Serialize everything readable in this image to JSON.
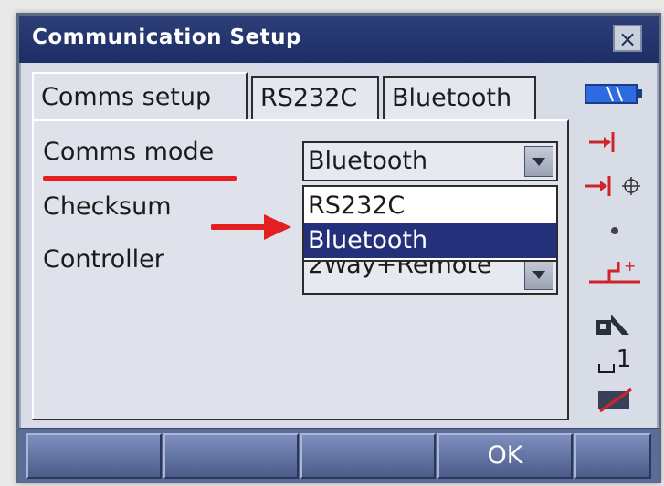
{
  "window": {
    "title": "Communication Setup",
    "close_label": "×"
  },
  "tabs": [
    {
      "label": "Comms setup",
      "active": true
    },
    {
      "label": "RS232C",
      "active": false
    },
    {
      "label": "Bluetooth",
      "active": false
    }
  ],
  "fields": {
    "comms_mode": {
      "label": "Comms mode",
      "value": "Bluetooth"
    },
    "checksum": {
      "label": "Checksum"
    },
    "controller": {
      "label": "Controller",
      "value": "2Way+Remote"
    }
  },
  "dropdown": {
    "options": [
      {
        "label": "RS232C",
        "selected": false
      },
      {
        "label": "Bluetooth",
        "selected": true
      }
    ]
  },
  "side_panel": {
    "icons": [
      "battery-icon",
      "input-arrow-icon",
      "input-target-icon",
      "dot-icon",
      "tilt-icon",
      "prism-icon",
      "face-icon",
      "edit-icon"
    ],
    "face_label": "1"
  },
  "softkeys": [
    "",
    "",
    "",
    "OK",
    ""
  ],
  "colors": {
    "titlebar": "#1d2d66",
    "selection": "#24307a",
    "annotation_red": "#e51f1f",
    "softkey_bar": "#5b6c98"
  }
}
